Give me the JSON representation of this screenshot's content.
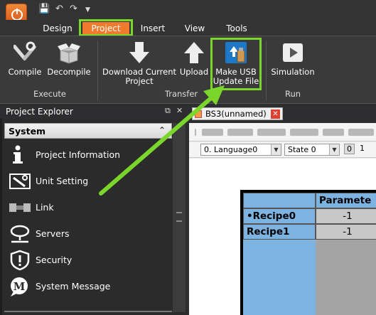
{
  "ribbon_tabs": [
    {
      "label": "Design"
    },
    {
      "label": "Project"
    },
    {
      "label": "Insert"
    },
    {
      "label": "View"
    },
    {
      "label": "Tools"
    }
  ],
  "active_tab": "Project",
  "ribbon": {
    "buttons": {
      "compile": "Compile",
      "decompile": "Decompile",
      "download_current_project_line1": "Download Current",
      "download_current_project_line2": "Project",
      "upload": "Upload",
      "make_usb_line1": "Make USB",
      "make_usb_line2": "Update File",
      "simulation": "Simulation"
    },
    "groups": {
      "execute": "Execute",
      "transfer": "Transfer",
      "run": "Run"
    }
  },
  "project_explorer": {
    "title": "Project Explorer",
    "section": "System",
    "items": [
      {
        "label": "Project Information",
        "icon": "info-icon"
      },
      {
        "label": "Unit Setting",
        "icon": "unit-setting-icon"
      },
      {
        "label": "Link",
        "icon": "link-icon"
      },
      {
        "label": "Servers",
        "icon": "servers-icon"
      },
      {
        "label": "Security",
        "icon": "security-icon"
      },
      {
        "label": "System Message",
        "icon": "system-message-icon"
      }
    ]
  },
  "document": {
    "tab_title": "BS3(unnamed)",
    "language_select": "0.  Language0",
    "state_select": "State 0",
    "state_number": "0",
    "extra_number": "1",
    "table": {
      "header": "Paramete",
      "rows": [
        {
          "name": "•Recipe0",
          "value": "-1"
        },
        {
          "name": "Recipe1",
          "value": "-1"
        }
      ]
    }
  },
  "colors": {
    "accent": "#f07a2e",
    "highlight": "#7bd62b"
  }
}
